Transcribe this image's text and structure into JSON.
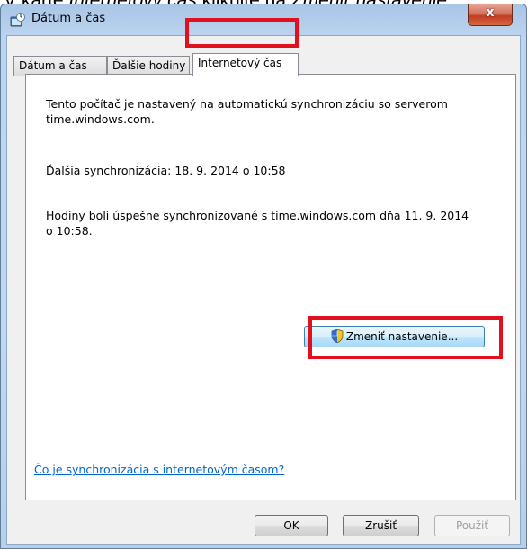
{
  "caption": {
    "part1": "V karte ",
    "part2": "Internetový čas",
    "part3": " kliknite na ",
    "part4": "Zmeniť nastavenie"
  },
  "window": {
    "title": "Dátum a čas",
    "close_label": "x"
  },
  "tabs": [
    {
      "label": "Dátum a čas",
      "active": false
    },
    {
      "label": "Ďalšie hodiny",
      "active": false
    },
    {
      "label": "Internetový čas",
      "active": true
    }
  ],
  "panel": {
    "sync_info_line1": "Tento počítač je nastavený na automatickú synchronizáciu so serverom",
    "sync_info_line2": "time.windows.com.",
    "next_sync": "Ďalšia synchronizácia: 18. 9. 2014 o 10:58",
    "last_sync_line1": "Hodiny boli úspešne synchronizované s time.windows.com dňa 11. 9. 2014",
    "last_sync_line2": "o 10:58.",
    "change_button": "Zmeniť nastavenie...",
    "help_link": "Čo je synchronizácia s internetovým časom?"
  },
  "footer": {
    "ok": "OK",
    "cancel": "Zrušiť",
    "apply": "Použiť"
  },
  "colors": {
    "highlight": "#e0101f",
    "link": "#0066cc"
  },
  "icons": [
    "clock-icon",
    "uac-shield-icon"
  ]
}
